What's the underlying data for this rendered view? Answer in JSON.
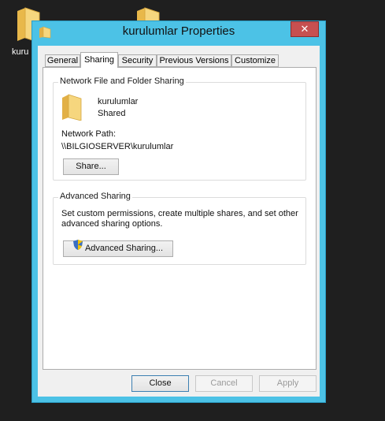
{
  "desktop": {
    "icons": [
      {
        "label": "kuru"
      }
    ]
  },
  "window": {
    "title": "kurulumlar Properties",
    "close_symbol": "✕",
    "tabs": [
      {
        "label": "General"
      },
      {
        "label": "Sharing"
      },
      {
        "label": "Security"
      },
      {
        "label": "Previous Versions"
      },
      {
        "label": "Customize"
      }
    ],
    "active_tab": "Sharing",
    "network_sharing": {
      "group_title": "Network File and Folder Sharing",
      "folder_name": "kurulumlar",
      "status": "Shared",
      "path_label": "Network Path:",
      "path_value": "\\\\BILGIOSERVER\\kurulumlar",
      "share_button": "Share..."
    },
    "advanced_sharing": {
      "group_title": "Advanced Sharing",
      "description_line1": "Set custom permissions, create multiple shares, and set other",
      "description_line2": "advanced sharing options.",
      "button_label": "Advanced Sharing..."
    },
    "footer": {
      "close_label": "Close",
      "cancel_label": "Cancel",
      "apply_label": "Apply"
    }
  },
  "colors": {
    "desktop_bg": "#1f1f1f",
    "window_frame": "#4cc2e6",
    "close_button": "#c75050",
    "folder_yellow": "#f3d27a"
  },
  "icons": [
    "folder-icon",
    "close-icon",
    "uac-shield-icon"
  ]
}
